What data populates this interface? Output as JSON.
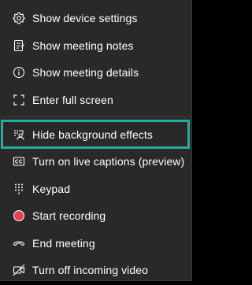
{
  "menu": {
    "items": [
      {
        "label": "Show device settings",
        "icon": "gear-icon"
      },
      {
        "label": "Show meeting notes",
        "icon": "notes-icon"
      },
      {
        "label": "Show meeting details",
        "icon": "info-icon"
      },
      {
        "label": "Enter full screen",
        "icon": "fullscreen-icon"
      },
      {
        "label": "Hide background effects",
        "icon": "background-effects-icon"
      },
      {
        "label": "Turn on live captions (preview)",
        "icon": "captions-icon"
      },
      {
        "label": "Keypad",
        "icon": "keypad-icon"
      },
      {
        "label": "Start recording",
        "icon": "record-icon"
      },
      {
        "label": "End meeting",
        "icon": "end-call-icon"
      },
      {
        "label": "Turn off incoming video",
        "icon": "video-off-icon"
      }
    ],
    "highlight_color": "#2aa9a3",
    "record_color": "#e8424f",
    "background_color": "#292929"
  }
}
